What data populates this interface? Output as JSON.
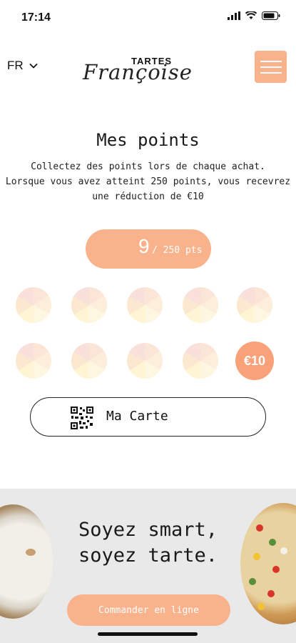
{
  "status_bar": {
    "time": "17:14"
  },
  "header": {
    "language": "FR",
    "logo_top": "TARTES",
    "logo_script": "Françoise"
  },
  "points": {
    "title": "Mes points",
    "description_lines": [
      "Collectez des points lors de chaque achat.",
      "Lorsque vous avez atteint 250 points, vous recevrez",
      "une réduction de €10"
    ],
    "current": "9",
    "total": "/ 250 pts",
    "progress_slices_filled": 0,
    "reward_label": "€10"
  },
  "card_button": {
    "label": "Ma Carte"
  },
  "banner": {
    "line1": "Soyez smart,",
    "line2": "soyez tarte.",
    "button": "Commander en ligne"
  },
  "colors": {
    "accent": "#f9b38c",
    "reward": "#f9a27a",
    "banner_bg": "#e9e9e9"
  },
  "icons": [
    "signal-icon",
    "wifi-icon",
    "battery-icon",
    "chevron-down-icon",
    "hamburger-menu-icon",
    "qr-code-icon"
  ]
}
